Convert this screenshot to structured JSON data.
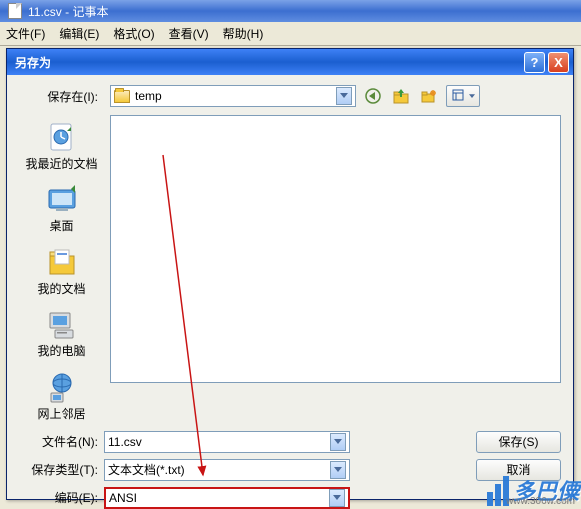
{
  "outer": {
    "title": "11.csv - 记事本"
  },
  "menubar": [
    "文件(F)",
    "编辑(E)",
    "格式(O)",
    "查看(V)",
    "帮助(H)"
  ],
  "dialog": {
    "title": "另存为",
    "help_symbol": "?",
    "close_symbol": "X",
    "save_in_label": "保存在(I):",
    "save_in_value": "temp",
    "places": {
      "recent": "我最近的文档",
      "desktop": "桌面",
      "mydocs": "我的文档",
      "mypc": "我的电脑",
      "network": "网上邻居"
    },
    "filename_label": "文件名(N):",
    "filename_value": "11.csv",
    "filetype_label": "保存类型(T):",
    "filetype_value": "文本文档(*.txt)",
    "encoding_label": "编码(E):",
    "encoding_value": "ANSI",
    "save_btn": "保存(S)",
    "cancel_btn": "取消"
  },
  "watermark": {
    "text": "多巴僳",
    "url": "www.306w.com"
  }
}
